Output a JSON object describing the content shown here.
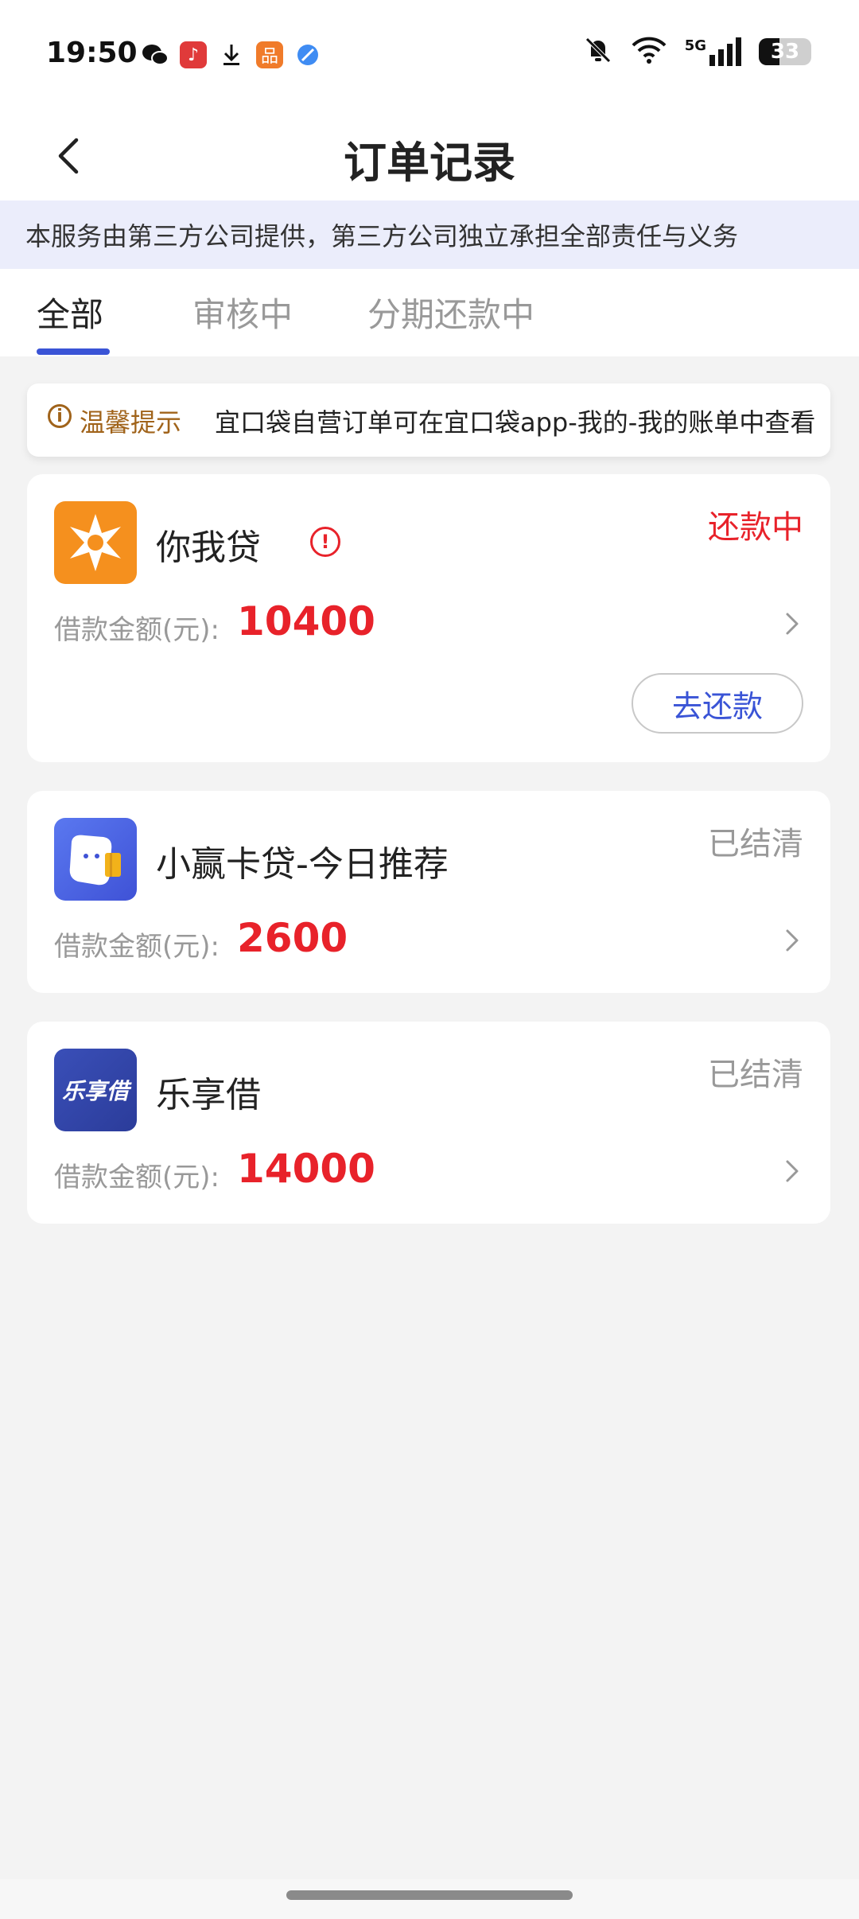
{
  "status_bar": {
    "time": "19:50",
    "battery": "33",
    "network": "5G"
  },
  "nav": {
    "title": "订单记录"
  },
  "disclaimer": "本服务由第三方公司提供，第三方公司独立承担全部责任与义务",
  "tabs": [
    {
      "label": "全部",
      "active": true
    },
    {
      "label": "审核中",
      "active": false
    },
    {
      "label": "分期还款中",
      "active": false
    }
  ],
  "notice": {
    "label": "温馨提示",
    "text": "宜口袋自营订单可在宜口袋app-我的-我的账单中查看"
  },
  "orders": [
    {
      "name": "你我贷",
      "status": "还款中",
      "status_color": "#e8222a",
      "amount_label": "借款金额(元):",
      "amount": "10400",
      "action": "去还款"
    },
    {
      "name": "小赢卡贷-今日推荐",
      "status": "已结清",
      "status_color": "#999999",
      "amount_label": "借款金额(元):",
      "amount": "2600"
    },
    {
      "name": "乐享借",
      "logo_text": "乐享借",
      "status": "已结清",
      "status_color": "#999999",
      "amount_label": "借款金额(元):",
      "amount": "14000"
    }
  ],
  "colors": {
    "accent": "#3a54d6",
    "danger": "#e8222a",
    "notice": "#a0631a"
  }
}
